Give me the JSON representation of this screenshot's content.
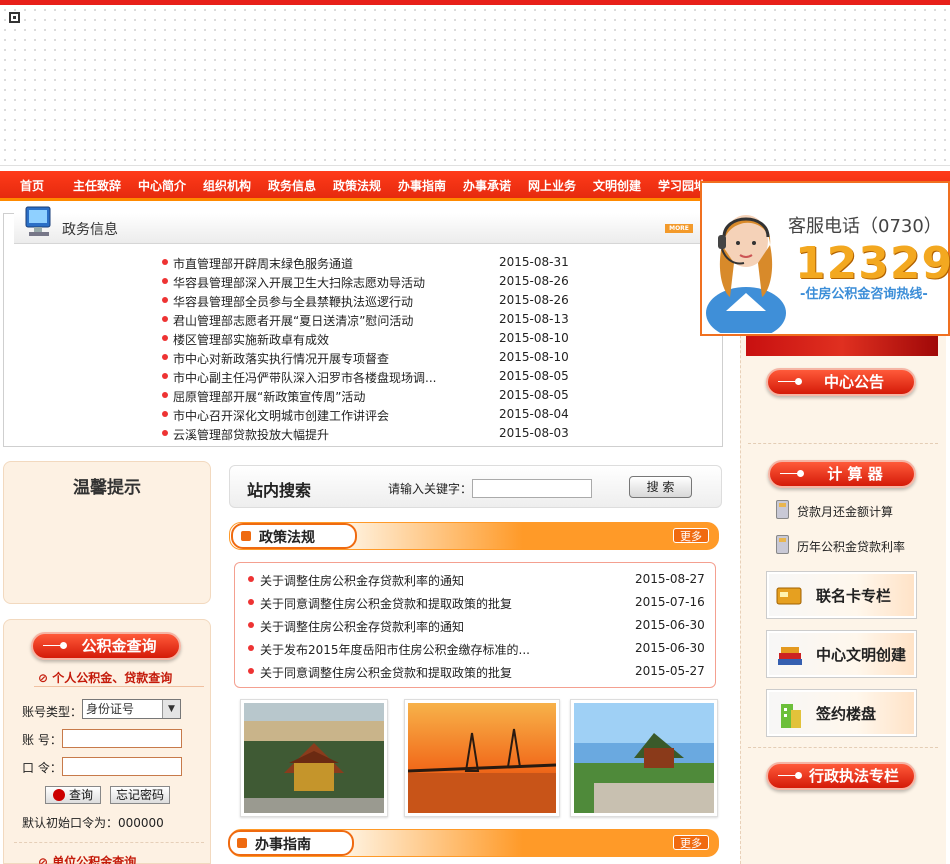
{
  "nav": {
    "items": [
      "首页",
      "主任致辞",
      "中心简介",
      "组织机构",
      "政务信息",
      "政策法规",
      "办事指南",
      "办事承诺",
      "网上业务",
      "文明创建",
      "学习园地"
    ]
  },
  "gov_info": {
    "title": "政务信息",
    "more": "MORE",
    "items": [
      {
        "title": "市直管理部开辟周末绿色服务通道",
        "date": "2015-08-31"
      },
      {
        "title": "华容县管理部深入开展卫生大扫除志愿劝导活动",
        "date": "2015-08-26"
      },
      {
        "title": "华容县管理部全员参与全县禁鞭执法巡逻行动",
        "date": "2015-08-26"
      },
      {
        "title": "君山管理部志愿者开展“夏日送清凉”慰问活动",
        "date": "2015-08-13"
      },
      {
        "title": "楼区管理部实施新政卓有成效",
        "date": "2015-08-10"
      },
      {
        "title": "市中心对新政落实执行情况开展专项督查",
        "date": "2015-08-10"
      },
      {
        "title": "市中心副主任冯俨带队深入汨罗市各楼盘现场调...",
        "date": "2015-08-05"
      },
      {
        "title": "屈原管理部开展“新政策宣传周”活动",
        "date": "2015-08-05"
      },
      {
        "title": "市中心召开深化文明城市创建工作讲评会",
        "date": "2015-08-04"
      },
      {
        "title": "云溪管理部贷款投放大幅提升",
        "date": "2015-08-03"
      }
    ]
  },
  "tips": {
    "title": "温馨提示"
  },
  "gjj_query": {
    "header": "公积金查询",
    "personal_title": "个人公积金、贷款查询",
    "account_type_label": "账号类型：",
    "account_type_value": "身份证号",
    "account_label": "账 号：",
    "password_label": "口 令：",
    "query_button": "查询",
    "forgot_button": "忘记密码",
    "default_pwd_hint": "默认初始口令为：000000",
    "unit_title": "单位公积金查询"
  },
  "search": {
    "title": "站内搜索",
    "label": "请输入关键字：",
    "button": "搜 索"
  },
  "policy": {
    "title": "政策法规",
    "more": "更多",
    "items": [
      {
        "title": "关于调整住房公积金存贷款利率的通知",
        "date": "2015-08-27"
      },
      {
        "title": "关于同意调整住房公积金贷款和提取政策的批复",
        "date": "2015-07-16"
      },
      {
        "title": "关于调整住房公积金存贷款利率的通知",
        "date": "2015-06-30"
      },
      {
        "title": "关于发布2015年度岳阳市住房公积金缴存标准的...",
        "date": "2015-06-30"
      },
      {
        "title": "关于同意调整住房公积金贷款和提取政策的批复",
        "date": "2015-05-27"
      }
    ]
  },
  "guide": {
    "title": "办事指南",
    "more": "更多"
  },
  "right": {
    "notice_title": "中心公告",
    "calc_title": "计 算 器",
    "calc_items": [
      "贷款月还金额计算",
      "历年公积金贷款利率"
    ],
    "boxes": [
      "联名卡专栏",
      "中心文明创建",
      "签约楼盘"
    ],
    "law_title": "行政执法专栏"
  },
  "customer_service": {
    "title": "客服电话（0730）",
    "number": "12329",
    "subtitle": "-住房公积金咨询热线-"
  },
  "colors": {
    "nav_red": "#e62a0e",
    "accent_orange": "#ff9a28",
    "bullet_red": "#e33333"
  }
}
